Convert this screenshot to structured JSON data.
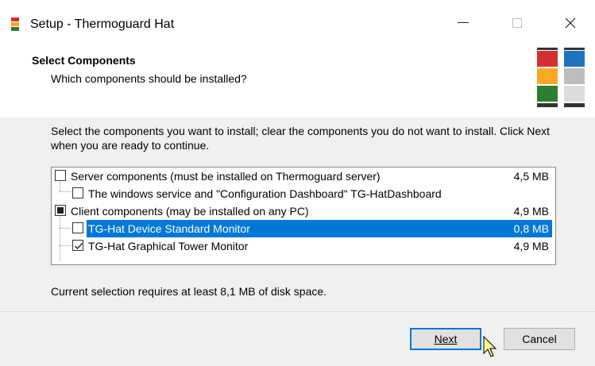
{
  "window": {
    "title": "Setup - Thermoguard Hat"
  },
  "header": {
    "title": "Select Components",
    "subtitle": "Which components should be installed?"
  },
  "body": {
    "description": "Select the components you want to install; clear the components you do not want to install. Click Next when you are ready to continue.",
    "items": [
      {
        "label": "Server components (must be installed on Thermoguard server)",
        "size": "4,5 MB",
        "state": "unchecked"
      },
      {
        "label": "The windows service and \"Configuration Dashboard\" TG-HatDashboard",
        "size": "",
        "state": "unchecked"
      },
      {
        "label": "Client components (may be installed on any PC)",
        "size": "4,9 MB",
        "state": "partial"
      },
      {
        "label": "TG-Hat Device Standard Monitor",
        "size": "0,8 MB",
        "state": "unchecked"
      },
      {
        "label": "TG-Hat Graphical Tower Monitor",
        "size": "4,9 MB",
        "state": "checked"
      }
    ],
    "status": "Current selection requires at least 8,1 MB of disk space."
  },
  "footer": {
    "next_label": "Next",
    "cancel_label": "Cancel"
  },
  "colors": {
    "selection": "#0078d7"
  }
}
